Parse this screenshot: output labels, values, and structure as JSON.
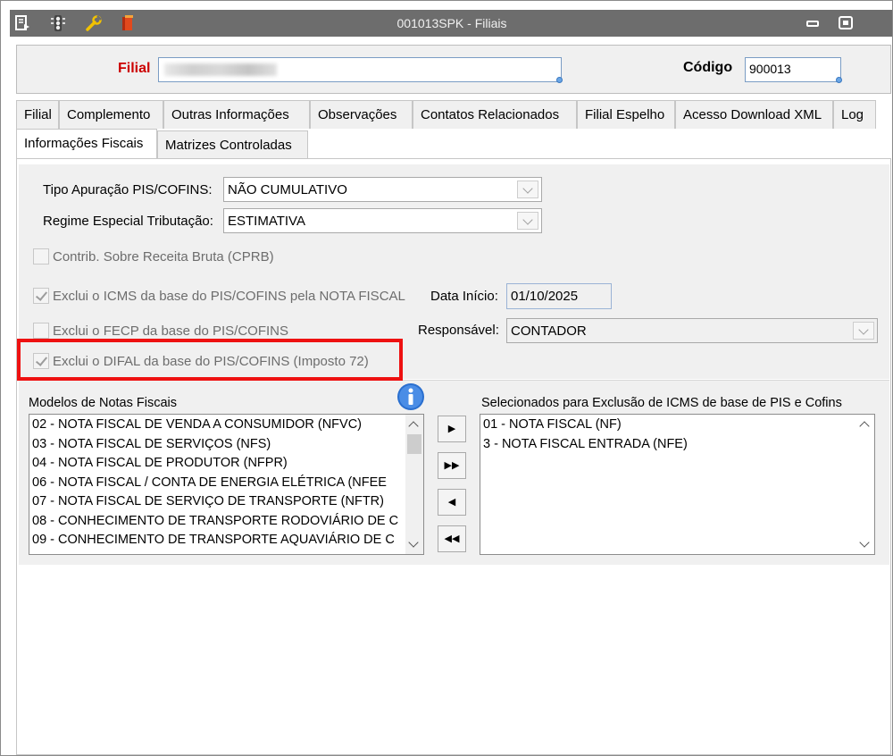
{
  "window": {
    "title": "001013SPK - Filiais"
  },
  "toolbar_icons": [
    "document-arrow-icon",
    "traffic-light-icon",
    "wrench-icon",
    "book-icon"
  ],
  "window_controls": [
    "minimize-icon",
    "restore-icon"
  ],
  "header": {
    "filial_label": "Filial",
    "filial_value": "",
    "codigo_label": "Código",
    "codigo_value": "900013"
  },
  "tabs_row1": [
    "Filial",
    "Complemento",
    "Outras Informações",
    "Observações",
    "Contatos Relacionados",
    "Filial Espelho",
    "Acesso Download XML",
    "Log"
  ],
  "tabs_row2": [
    "Informações Fiscais",
    "Matrizes Controladas"
  ],
  "active_tab": "Informações Fiscais",
  "fiscal": {
    "tipo_apuracao_label": "Tipo Apuração PIS/COFINS:",
    "tipo_apuracao_value": "NÃO CUMULATIVO",
    "regime_label": "Regime Especial Tributação:",
    "regime_value": "ESTIMATIVA",
    "cprb_label": "Contrib. Sobre Receita Bruta (CPRB)",
    "cprb_checked": false,
    "icms_label": "Exclui o ICMS da base do PIS/COFINS pela NOTA FISCAL",
    "icms_checked": true,
    "fecp_label": "Exclui o FECP da base do PIS/COFINS",
    "fecp_checked": false,
    "difal_label": "Exclui o DIFAL da base do PIS/COFINS (Imposto 72)",
    "difal_checked": true,
    "data_inicio_label": "Data Início:",
    "data_inicio_value": "01/10/2025",
    "responsavel_label": "Responsável:",
    "responsavel_value": "CONTADOR",
    "highlight_color": "#ee1111"
  },
  "lists": {
    "modelos_label": "Modelos de Notas Fiscais",
    "modelos_items": [
      "02  - NOTA FISCAL DE VENDA A CONSUMIDOR (NFVC)",
      "03  - NOTA FISCAL DE SERVIÇOS (NFS)",
      "04  - NOTA FISCAL DE PRODUTOR (NFPR)",
      "06  - NOTA FISCAL / CONTA DE ENERGIA ELÉTRICA (NFEE",
      "07  - NOTA FISCAL DE SERVIÇO DE TRANSPORTE (NFTR)",
      "08  - CONHECIMENTO DE TRANSPORTE RODOVIÁRIO DE C",
      "09  - CONHECIMENTO DE TRANSPORTE AQUAVIÁRIO DE C"
    ],
    "selecionados_label": "Selecionados para Exclusão de ICMS de base de PIS e Cofins",
    "selecionados_items": [
      "01  - NOTA FISCAL (NF)",
      "3    - NOTA FISCAL ENTRADA (NFE)"
    ],
    "buttons": [
      "▶",
      "▶▶",
      "◀",
      "◀◀"
    ]
  }
}
